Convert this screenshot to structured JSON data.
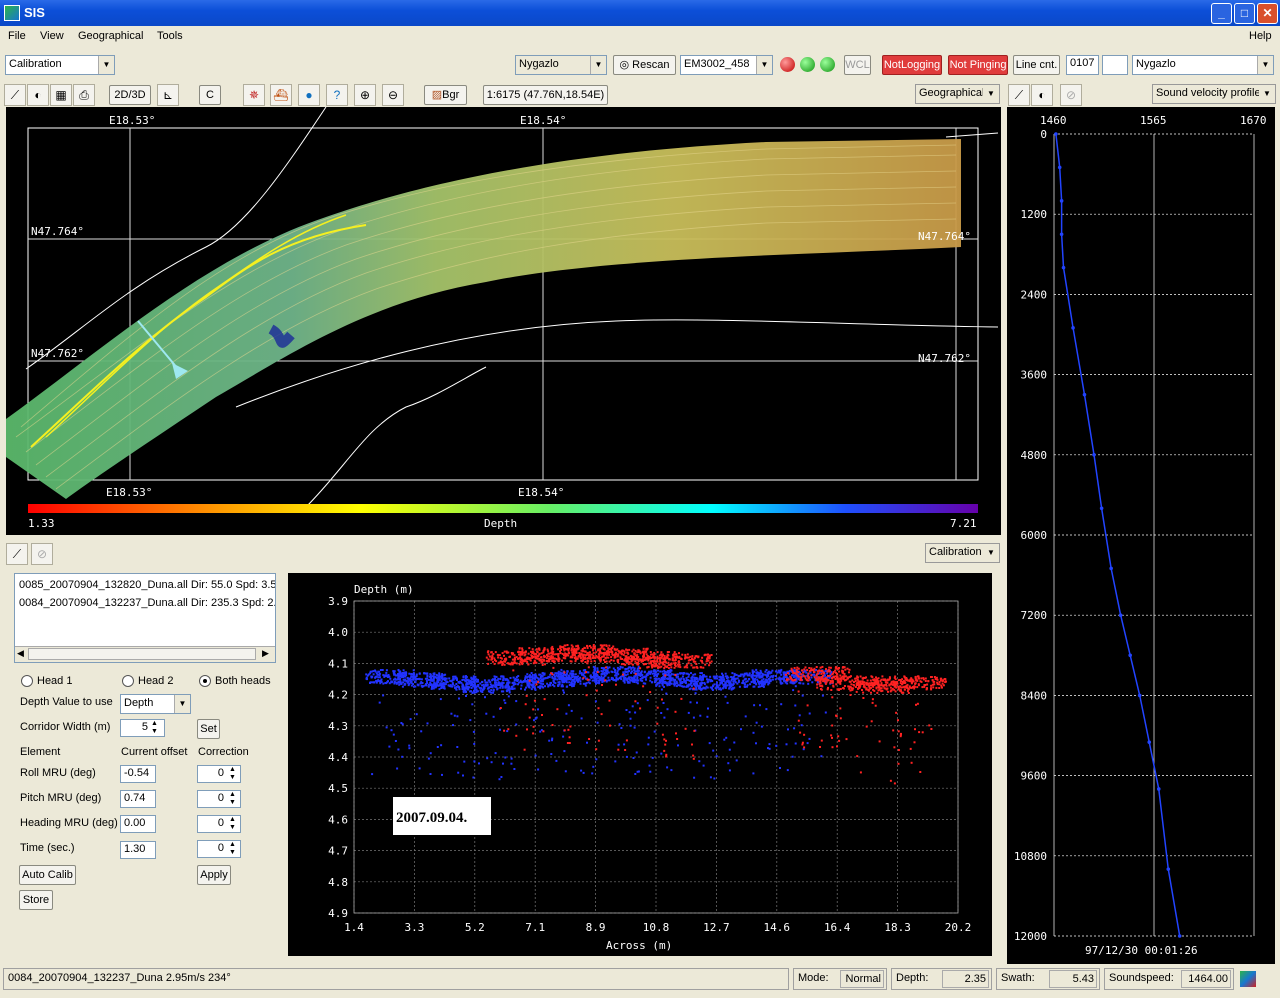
{
  "window": {
    "title": "SIS"
  },
  "menu": {
    "file": "File",
    "view": "View",
    "geographical": "Geographical",
    "tools": "Tools",
    "help": "Help"
  },
  "toolbar": {
    "mode_select": "Calibration",
    "survey_select": "Nygazlo",
    "rescan": "Rescan",
    "sounder_select": "EM3002_458",
    "wcl": "WCL",
    "not_logging": "NotLogging",
    "not_pinging": "Not Pinging",
    "line_cnt": "Line cnt.",
    "line_cnt_value": "0107",
    "project_select": "Nygazlo"
  },
  "geo_toolbar": {
    "btn_2d3d": "2D/3D",
    "btn_c": "C",
    "bgr": "Bgr",
    "scale_info": "1:6175 (47.76N,18.54E)",
    "view_select": "Geographical"
  },
  "map": {
    "lon_labels": [
      "E18.53°",
      "E18.54°"
    ],
    "lat_labels": [
      "N47.764°",
      "N47.762°"
    ],
    "colorbar_min": "1.33",
    "colorbar_max": "7.21",
    "colorbar_label": "Depth"
  },
  "svp": {
    "menu": "Sound velocity profile",
    "x_ticks": [
      "1460",
      "1565",
      "1670"
    ],
    "y_ticks": [
      "0",
      "1200",
      "2400",
      "3600",
      "4800",
      "6000",
      "7200",
      "8400",
      "9600",
      "10800",
      "12000"
    ],
    "timestamp": "97/12/30 00:01:26"
  },
  "calib": {
    "select": "Calibration",
    "files": [
      "0085_20070904_132820_Duna.all Dir: 55.0 Spd: 3.5",
      "0084_20070904_132237_Duna.all Dir: 235.3 Spd: 2."
    ],
    "head1": "Head 1",
    "head2": "Head 2",
    "both": "Both heads",
    "depth_value_label": "Depth Value to use",
    "depth_value": "Depth",
    "corridor_label": "Corridor Width (m)",
    "corridor_value": "5",
    "set": "Set",
    "col_element": "Element",
    "col_offset": "Current offset",
    "col_correction": "Correction",
    "rows": [
      {
        "name": "Roll MRU (deg)",
        "offset": "-0.54",
        "corr": "0"
      },
      {
        "name": "Pitch MRU (deg)",
        "offset": "0.74",
        "corr": "0"
      },
      {
        "name": "Heading MRU (deg)",
        "offset": "0.00",
        "corr": "0"
      },
      {
        "name": "Time (sec.)",
        "offset": "1.30",
        "corr": "0"
      }
    ],
    "auto_calib": "Auto Calib",
    "apply": "Apply",
    "store": "Store"
  },
  "chart_data": {
    "type": "scatter",
    "ylabel": "Depth (m)",
    "xlabel": "Across (m)",
    "x_ticks": [
      "1.4",
      "3.3",
      "5.2",
      "7.1",
      "8.9",
      "10.8",
      "12.7",
      "14.6",
      "16.4",
      "18.3",
      "20.2"
    ],
    "y_ticks": [
      "3.9",
      "4.0",
      "4.1",
      "4.2",
      "4.3",
      "4.4",
      "4.5",
      "4.6",
      "4.7",
      "4.8",
      "4.9"
    ],
    "xlim": [
      1.4,
      20.2
    ],
    "ylim": [
      3.9,
      4.9
    ],
    "annotation": "2007.09.04.",
    "series": [
      {
        "color": "#2233ff",
        "x": [
          2.5,
          3.5,
          4.5,
          5.5,
          6.5,
          7.5,
          8.5,
          9.5,
          10.5,
          11.5,
          12.5,
          13.5,
          14.5,
          15.5
        ],
        "y": [
          4.14,
          4.15,
          4.16,
          4.17,
          4.16,
          4.15,
          4.14,
          4.13,
          4.14,
          4.15,
          4.16,
          4.15,
          4.14,
          4.14
        ]
      },
      {
        "color": "#ff2222",
        "x": [
          6.5,
          7.5,
          8.5,
          9.5,
          10.5,
          11.5,
          15.8,
          16.8,
          17.8,
          18.8
        ],
        "y": [
          4.08,
          4.07,
          4.06,
          4.07,
          4.08,
          4.09,
          4.13,
          4.16,
          4.17,
          4.16
        ]
      }
    ]
  },
  "statusbar": {
    "file": "0084_20070904_132237_Duna 2.95m/s 234°",
    "mode_label": "Mode:",
    "mode": "Normal",
    "depth_label": "Depth:",
    "depth": "2.35",
    "swath_label": "Swath:",
    "swath": "5.43",
    "soundspeed_label": "Soundspeed:",
    "soundspeed": "1464.00"
  }
}
